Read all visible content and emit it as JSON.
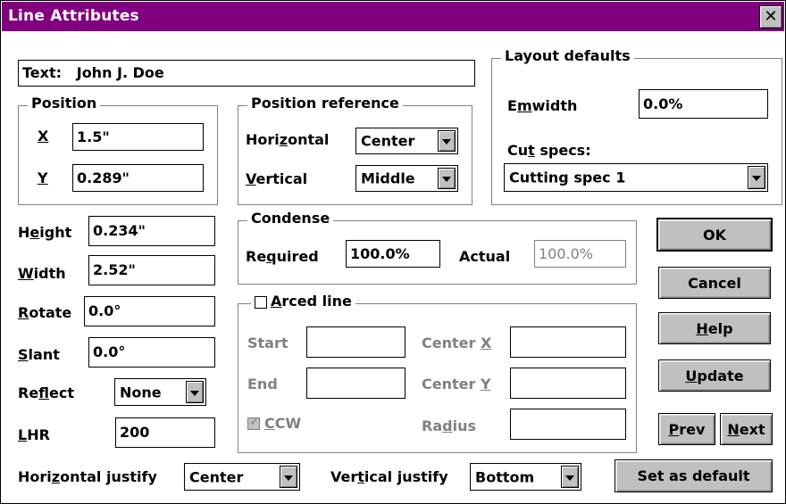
{
  "window": {
    "title": "Line Attributes",
    "close_glyph": "✕"
  },
  "text_field": {
    "label": "Text:",
    "value": "John J. Doe"
  },
  "position": {
    "title": "Position",
    "x_label_u": "X",
    "x_value": "1.5\"",
    "y_label_u": "Y",
    "y_value": "0.289\""
  },
  "position_reference": {
    "title": "Position reference",
    "horizontal": {
      "label_a": "Hori",
      "label_u": "z",
      "label_b": "ontal",
      "value": "Center"
    },
    "vertical": {
      "label_u": "V",
      "label_b": "ertical",
      "value": "Middle"
    }
  },
  "layout_defaults": {
    "title": "Layout defaults",
    "emwidth": {
      "label_a": "E",
      "label_u": "m",
      "label_b": "width",
      "value": "0.0%"
    },
    "cut_specs": {
      "label_a": "Cu",
      "label_u": "t",
      "label_b": " specs:",
      "value": "Cutting spec 1"
    }
  },
  "height": {
    "label_a": "H",
    "label_u": "e",
    "label_b": "ight",
    "value": "0.234\""
  },
  "width": {
    "label_u": "W",
    "label_b": "idth",
    "value": "2.52\""
  },
  "rotate": {
    "label_u": "R",
    "label_b": "otate",
    "value": "0.0°"
  },
  "slant": {
    "label_u": "S",
    "label_b": "lant",
    "value": "0.0°"
  },
  "reflect": {
    "label_a": "Re",
    "label_u": "f",
    "label_b": "lect",
    "value": "None"
  },
  "lhr": {
    "label_u": "L",
    "label_b": "HR",
    "value": "200"
  },
  "condense": {
    "title": "Condense",
    "required": {
      "label_a": "Re",
      "label_u": "q",
      "label_b": "uired",
      "value": "100.0%"
    },
    "actual": {
      "label": "Actual",
      "value": "100.0%"
    }
  },
  "arced_line": {
    "label_u": "A",
    "label_b": "rced line",
    "checked": false,
    "start": {
      "label": "Start",
      "value": ""
    },
    "end": {
      "label": "End",
      "value": ""
    },
    "ccw": {
      "label_u": "C",
      "label_b": "CW",
      "checked": true,
      "mark": "✓"
    },
    "center_x": {
      "label_a": "Center ",
      "label_u": "X",
      "value": ""
    },
    "center_y": {
      "label_a": "Center ",
      "label_u": "Y",
      "value": ""
    },
    "radius": {
      "label_a": "Ra",
      "label_u": "d",
      "label_b": "ius",
      "value": ""
    }
  },
  "buttons": {
    "ok": "OK",
    "cancel": "Cancel",
    "help_u": "H",
    "help_b": "elp",
    "update_u": "U",
    "update_b": "pdate",
    "prev_u": "P",
    "prev_b": "rev",
    "next_u": "N",
    "next_b": "ext",
    "set_default": "Set as default"
  },
  "horizontal_justify": {
    "label_a": "Hori",
    "label_u": "z",
    "label_b": "ontal justify",
    "value": "Center"
  },
  "vertical_justify": {
    "label_a": "Ver",
    "label_u": "t",
    "label_b": "ical justify",
    "value": "Bottom"
  }
}
